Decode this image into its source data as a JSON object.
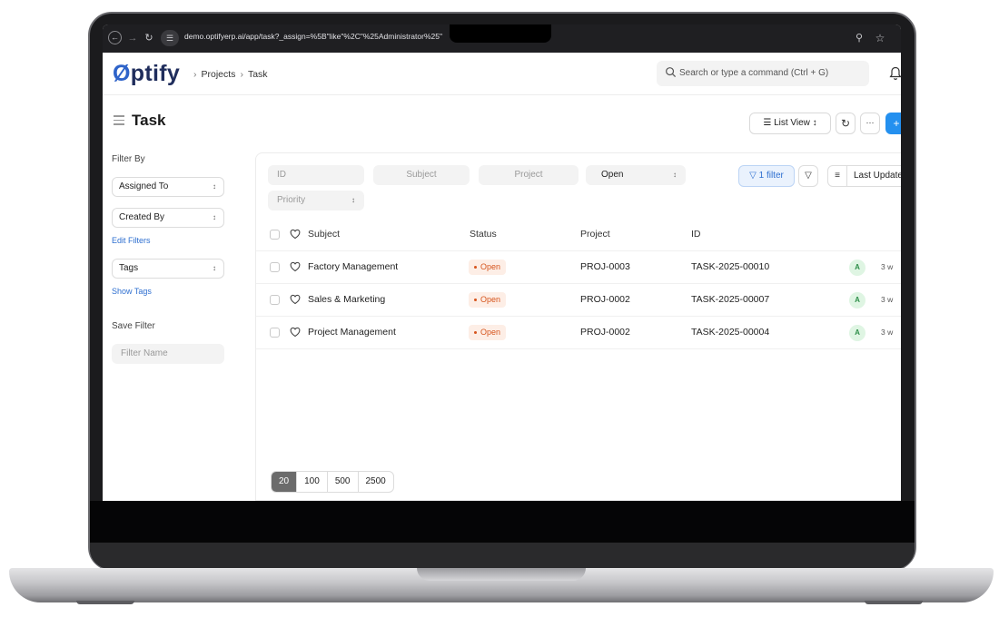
{
  "browser": {
    "url": "demo.optifyerp.ai/app/task?_assign=%5B\"like\"%2C\"%25Administrator%25\""
  },
  "header": {
    "logo": "Optify",
    "breadcrumbs": [
      "Projects",
      "Task"
    ],
    "search_placeholder": "Search or type a command (Ctrl + G)"
  },
  "page": {
    "title": "Task",
    "list_view_label": "List View",
    "add_label": "+"
  },
  "sidebar": {
    "filter_by_label": "Filter By",
    "assigned_to": "Assigned To",
    "created_by": "Created By",
    "edit_filters": "Edit Filters",
    "tags": "Tags",
    "show_tags": "Show Tags",
    "save_filter_label": "Save Filter",
    "filter_name_placeholder": "Filter Name"
  },
  "filters": {
    "id_placeholder": "ID",
    "subject_placeholder": "Subject",
    "project_placeholder": "Project",
    "status_value": "Open",
    "priority_placeholder": "Priority",
    "filter_button": "1 filter",
    "sort_label": "Last Updated On"
  },
  "table": {
    "columns": {
      "subject": "Subject",
      "status": "Status",
      "project": "Project",
      "id": "ID"
    },
    "rows": [
      {
        "subject": "Factory Management",
        "status": "Open",
        "project": "PROJ-0003",
        "id": "TASK-2025-00010",
        "avatar": "A",
        "modified": "3 w"
      },
      {
        "subject": "Sales & Marketing",
        "status": "Open",
        "project": "PROJ-0002",
        "id": "TASK-2025-00007",
        "avatar": "A",
        "modified": "3 w"
      },
      {
        "subject": "Project Management",
        "status": "Open",
        "project": "PROJ-0002",
        "id": "TASK-2025-00004",
        "avatar": "A",
        "modified": "3 w"
      }
    ]
  },
  "pagination": {
    "page_sizes": [
      "20",
      "100",
      "500",
      "2500"
    ],
    "active": "20"
  },
  "colors": {
    "accent": "#2490ef",
    "logo_dark": "#1f2d5c",
    "logo_accent": "#2e63c9",
    "status_open": "#d6541c"
  }
}
